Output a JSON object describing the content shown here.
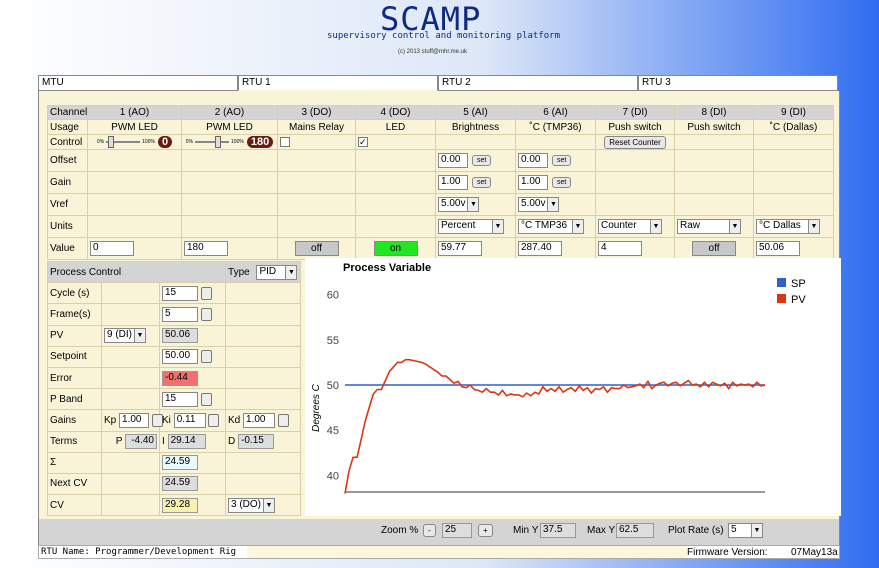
{
  "header": {
    "title": "SCAMP",
    "subtitle": "supervisory control and monitoring platform",
    "copyright": "(c) 2013 stuff@mhr.me.uk"
  },
  "tabs": [
    {
      "label": "MTU"
    },
    {
      "label": "RTU 1"
    },
    {
      "label": "RTU 2"
    },
    {
      "label": "RTU 3"
    }
  ],
  "io": {
    "row_labels": {
      "channel": "Channel",
      "usage": "Usage",
      "control": "Control",
      "offset": "Offset",
      "gain": "Gain",
      "vref": "Vref",
      "units": "Units",
      "value": "Value"
    },
    "channels": [
      {
        "channel": "1 (AO)",
        "usage": "PWM LED",
        "slider_min": "0%",
        "slider_max": "100%",
        "control_value": "0",
        "value": "0",
        "slider_fraction": 0.05
      },
      {
        "channel": "2 (AO)",
        "usage": "PWM LED",
        "slider_min": "0%",
        "slider_max": "100%",
        "control_value": "180",
        "value": "180",
        "slider_fraction": 0.7
      },
      {
        "channel": "3 (DO)",
        "usage": "Mains Relay",
        "checked": false,
        "value": "off"
      },
      {
        "channel": "4 (DO)",
        "usage": "LED",
        "checked": true,
        "value": "on"
      },
      {
        "channel": "5 (AI)",
        "usage": "Brightness",
        "offset": "0.00",
        "gain": "1.00",
        "vref": "5.00v",
        "units": "Percent",
        "value": "59.77"
      },
      {
        "channel": "6 (AI)",
        "usage": "˚C (TMP36)",
        "offset": "0.00",
        "gain": "1.00",
        "vref": "5.00v",
        "units": "°C TMP36",
        "value": "287.40"
      },
      {
        "channel": "7 (DI)",
        "usage": "Push switch",
        "button": "Reset Counter",
        "units": "Counter",
        "value": "4"
      },
      {
        "channel": "8 (DI)",
        "usage": "Push switch",
        "units": "Raw",
        "value": "off"
      },
      {
        "channel": "9 (DI)",
        "usage": "˚C (Dallas)",
        "units": "°C Dallas",
        "value": "50.06"
      }
    ],
    "set_label": "set"
  },
  "process": {
    "title": "Process Control",
    "type_label": "Type",
    "type_value": "PID",
    "cycle_label": "Cycle (s)",
    "cycle": "15",
    "frame_label": "Frame(s)",
    "frame": "5",
    "pv_label": "PV",
    "pv_source": "9 (DI)",
    "pv": "50.06",
    "setpoint_label": "Setpoint",
    "setpoint": "50.00",
    "error_label": "Error",
    "error": "-0.44",
    "pband_label": "P Band",
    "pband": "15",
    "gains_label": "Gains",
    "kp_label": "Kp",
    "kp": "1.00",
    "ki_label": "Ki",
    "ki": "0.11",
    "kd_label": "Kd",
    "kd": "1.00",
    "terms_label": "Terms",
    "p_label": "P",
    "p": "-4.40",
    "i_label": "I",
    "i": "29.14",
    "d_label": "D",
    "d": "-0.15",
    "sigma_label": "Σ",
    "sigma": "24.59",
    "next_cv_label": "Next CV",
    "next_cv": "24.59",
    "cv_label": "CV",
    "cv": "29.28",
    "cv_target": "3 (DO)"
  },
  "chart_data": {
    "type": "line",
    "title": "Process Variable",
    "ylabel": "Degrees C",
    "ylim": [
      37.5,
      62.5
    ],
    "yticks": [
      "60",
      "55",
      "50",
      "45",
      "40"
    ],
    "colors": {
      "SP": "#3060c8",
      "PV": "#d83810"
    },
    "series": [
      {
        "name": "SP",
        "values": [
          50,
          50,
          50,
          50,
          50,
          50,
          50,
          50,
          50,
          50,
          50,
          50,
          50,
          50,
          50,
          50,
          50,
          50,
          50,
          50,
          50,
          50,
          50,
          50,
          50,
          50,
          50,
          50,
          50,
          50,
          50,
          50,
          50,
          50,
          50,
          50,
          50,
          50,
          50,
          50,
          50,
          50,
          50,
          50,
          50,
          50,
          50,
          50,
          50,
          50,
          50,
          50,
          50,
          50,
          50,
          50,
          50,
          50,
          50,
          50,
          50,
          50,
          50,
          50,
          50,
          50,
          50,
          50,
          50,
          50,
          50,
          50,
          50,
          50,
          50,
          50,
          50,
          50,
          50,
          50,
          50,
          50,
          50,
          50,
          50,
          50,
          50,
          50,
          50,
          50,
          50,
          50,
          50,
          50,
          50,
          50,
          50,
          50,
          50,
          50,
          50,
          50,
          50,
          50,
          50
        ]
      },
      {
        "name": "PV",
        "values": [
          38,
          40.5,
          42,
          42,
          44,
          46,
          47.5,
          49,
          49.5,
          49.5,
          50.5,
          51.5,
          52,
          52.5,
          52.5,
          52.8,
          52.8,
          52.7,
          52.6,
          52.5,
          52.3,
          52,
          51.7,
          51.4,
          51,
          51,
          50.6,
          50.2,
          50.4,
          49.8,
          49.7,
          50,
          49.5,
          49.4,
          49.2,
          49.6,
          49.2,
          49.2,
          48.9,
          49.4,
          48.8,
          49,
          48.9,
          48.9,
          48.7,
          49.1,
          48.8,
          49.2,
          49,
          49.8,
          49.3,
          49.6,
          49.3,
          49.8,
          49.2,
          49.5,
          49.7,
          49.3,
          49.9,
          49.4,
          49.7,
          49.1,
          49.6,
          49.5,
          49.8,
          49.2,
          49.7,
          49.6,
          49.6,
          50,
          49.7,
          49.8,
          49.9,
          50.1,
          49.7,
          50.4,
          49.6,
          50,
          50.2,
          50.3,
          49.9,
          50.2,
          50.3,
          49.9,
          50.2,
          50.5,
          50,
          50.1,
          49.8,
          50.3,
          49.8,
          50.3,
          50.1,
          49.9,
          50.2,
          49.6,
          50.3,
          49.9,
          50.1,
          50,
          50.1,
          49.8,
          50.3,
          49.9,
          50
        ]
      }
    ]
  },
  "bottom": {
    "zoom_label": "Zoom %",
    "zoom_minus": "-",
    "zoom": "25",
    "zoom_plus": "+",
    "min_y_label": "Min Y",
    "min_y": "37.5",
    "max_y_label": "Max Y",
    "max_y": "62.5",
    "plot_rate_label": "Plot Rate (s)",
    "plot_rate": "5"
  },
  "footer": {
    "rtu_name": "RTU Name: Programmer/Development Rig",
    "firmware_label": "Firmware Version:",
    "firmware": "07May13a"
  }
}
